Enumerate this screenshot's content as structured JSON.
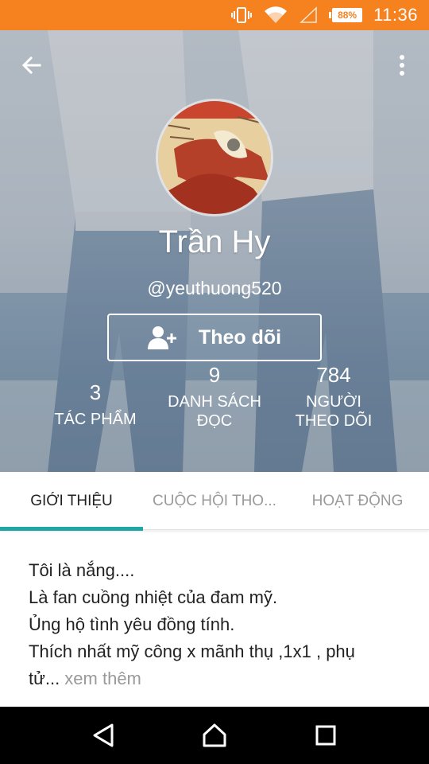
{
  "status_bar": {
    "time": "11:36",
    "battery_percent": "88%",
    "icons": [
      "vibrate-icon",
      "wifi-icon",
      "signal-icon",
      "battery-icon"
    ]
  },
  "profile": {
    "display_name": "Trần Hy",
    "username": "@yeuthuong520",
    "follow_label": "Theo dõi",
    "stats": [
      {
        "value": "3",
        "label": "TÁC PHẨM"
      },
      {
        "value": "9",
        "label": "DANH SÁCH ĐỌC"
      },
      {
        "value": "784",
        "label": "NGƯỜI THEO DÕI"
      }
    ]
  },
  "tabs": [
    {
      "label": "GIỚI THIỆU",
      "active": true
    },
    {
      "label": "CUỘC HỘI THO...",
      "active": false
    },
    {
      "label": "HOẠT ĐỘNG",
      "active": false
    }
  ],
  "bio": {
    "lines": [
      "Tôi là nắng....",
      "Là fan cuồng nhiệt của đam mỹ.",
      "Ủng hộ tình yêu đồng tính.",
      "Thích nhất mỹ công x mãnh thụ ,1x1 , phụ",
      "tử..."
    ],
    "more_label": " xem thêm"
  },
  "colors": {
    "status_bar": "#f5811f",
    "tab_indicator": "#1fa7a7",
    "muted_text": "#9a9a9a"
  }
}
